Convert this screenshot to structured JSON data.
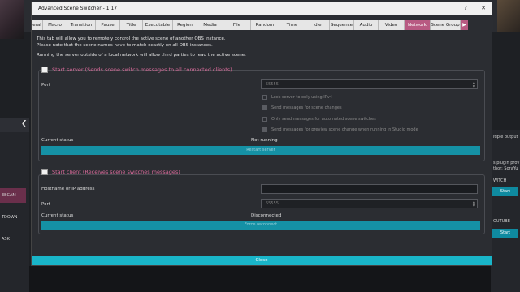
{
  "window": {
    "title": "Advanced Scene Switcher - 1.17",
    "help": "?",
    "close": "✕"
  },
  "tabs": [
    {
      "label": "eral"
    },
    {
      "label": "Macro"
    },
    {
      "label": "Transition"
    },
    {
      "label": "Pause"
    },
    {
      "label": "Title"
    },
    {
      "label": "Executable"
    },
    {
      "label": "Region"
    },
    {
      "label": "Media"
    },
    {
      "label": "File"
    },
    {
      "label": "Random"
    },
    {
      "label": "Time"
    },
    {
      "label": "Idle"
    },
    {
      "label": "Sequence"
    },
    {
      "label": "Audio"
    },
    {
      "label": "Video"
    },
    {
      "label": "Network"
    },
    {
      "label": "Scene Group"
    }
  ],
  "tab_scroll": "▶",
  "info": {
    "line1": "This tab will allow you to remotely control the active scene of another OBS instance.",
    "line2": "Please note that the scene names have to match exactly on all OBS instances.",
    "line3": "Running the server outside of a local network will allow third parties to read the active scene."
  },
  "server": {
    "title": "Start server (Sends scene switch messages to all connected clients)",
    "port_label": "Port",
    "port_value": "55555",
    "opt1": "Lock server to only using IPv4",
    "opt2": "Send messages for scene changes",
    "opt3": "Only send messages for automated scene switches",
    "opt4": "Send messages for preview scene change when running in Studio mode",
    "status_label": "Current status",
    "status_value": "Not running",
    "restart": "Restart server"
  },
  "client": {
    "title": "Start client (Receives scene switches messages)",
    "host_label": "Hostname or IP address",
    "port_label": "Port",
    "port_value": "55555",
    "status_label": "Current status",
    "status_value": "Disconnected",
    "reconnect": "Force reconnect"
  },
  "close": "Close",
  "background": {
    "left_items": [
      "EBCAM",
      "TDOWN",
      "ASK"
    ],
    "right_text": [
      "ltiple output",
      "s plugin prov",
      "thor: SoraYu",
      "WITCH",
      "OUTUBE"
    ],
    "right_buttons": [
      "Start",
      "Start"
    ]
  }
}
